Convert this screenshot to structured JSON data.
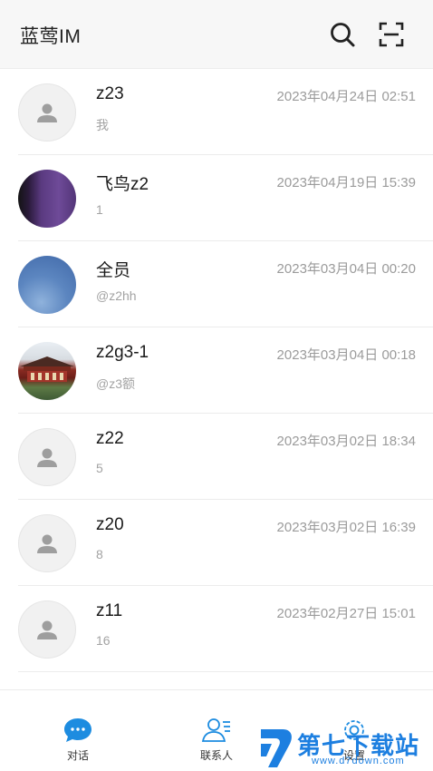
{
  "header": {
    "title": "蓝莺IM",
    "search_icon": "search-icon",
    "scan_icon": "scan-icon"
  },
  "conversations": [
    {
      "name": "z23",
      "time": "2023年04月24日 02:51",
      "preview": "我",
      "avatar": "default-avatar"
    },
    {
      "name": "飞鸟z2",
      "time": "2023年04月19日 15:39",
      "preview": "1",
      "avatar": "purple-photo"
    },
    {
      "name": "全员",
      "time": "2023年03月04日 00:20",
      "preview": "@z2hh",
      "avatar": "sky-photo"
    },
    {
      "name": "z2g3-1",
      "time": "2023年03月04日 00:18",
      "preview": "@z3额",
      "avatar": "building-photo"
    },
    {
      "name": "z22",
      "time": "2023年03月02日 18:34",
      "preview": "5",
      "avatar": "default-avatar"
    },
    {
      "name": "z20",
      "time": "2023年03月02日 16:39",
      "preview": "8",
      "avatar": "default-avatar"
    },
    {
      "name": "z11",
      "time": "2023年02月27日 15:01",
      "preview": "16",
      "avatar": "default-avatar"
    }
  ],
  "tabs": {
    "chat": {
      "label": "对话",
      "icon": "chat-bubble-icon",
      "active": true
    },
    "contacts": {
      "label": "联系人",
      "icon": "contacts-icon",
      "active": false
    },
    "settings": {
      "label": "设置",
      "icon": "gear-icon",
      "active": false
    }
  },
  "watermark": {
    "main": "第七下载站",
    "sub": "www.d7down.com"
  },
  "colors": {
    "accent": "#1d8ce0",
    "watermark": "#1d7fe0",
    "header_bg": "#f7f7f7"
  }
}
